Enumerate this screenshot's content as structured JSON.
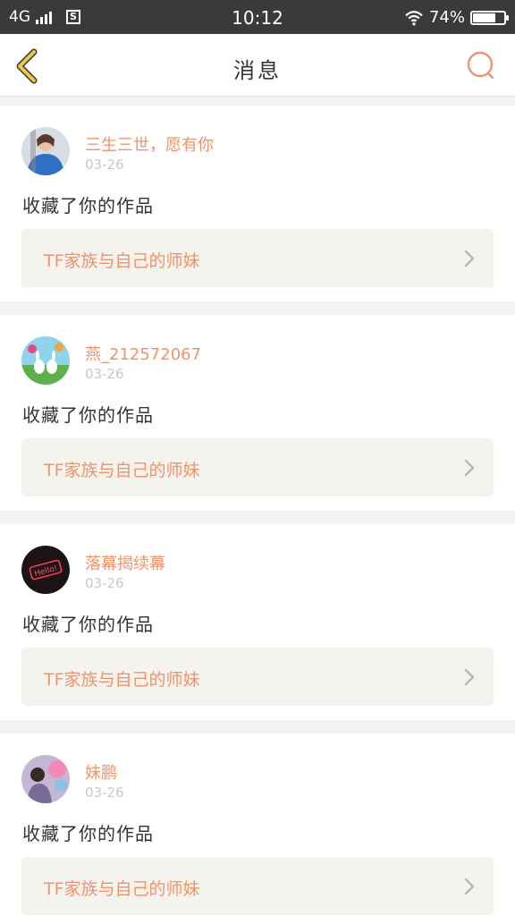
{
  "status_bar": {
    "network": "4G",
    "time": "10:12",
    "battery": "74%",
    "battery_level": 0.74
  },
  "header": {
    "title": "消息",
    "back_icon": "chevron-left-icon",
    "search_icon": "search-icon"
  },
  "colors": {
    "accent": "#f0936a",
    "back_icon": "#f2c64a",
    "card_footer_bg": "#f4f3ee",
    "page_bg": "#f3f3f3"
  },
  "messages": [
    {
      "user": "三生三世，愿有你",
      "date": "03-26",
      "action": "收藏了你的作品",
      "work_title": "TF家族与自己的师妹",
      "avatar_icon": "user-avatar-blue"
    },
    {
      "user": "燕_212572067",
      "date": "03-26",
      "action": "收藏了你的作品",
      "work_title": "TF家族与自己的师妹",
      "avatar_icon": "user-avatar-rabbits"
    },
    {
      "user": "落幕揭续幕",
      "date": "03-26",
      "action": "收藏了你的作品",
      "work_title": "TF家族与自己的师妹",
      "avatar_icon": "user-avatar-hello-neon"
    },
    {
      "user": "妹鹏",
      "date": "03-26",
      "action": "收藏了你的作品",
      "work_title": "TF家族与自己的师妹",
      "avatar_icon": "user-avatar-balloons"
    }
  ]
}
